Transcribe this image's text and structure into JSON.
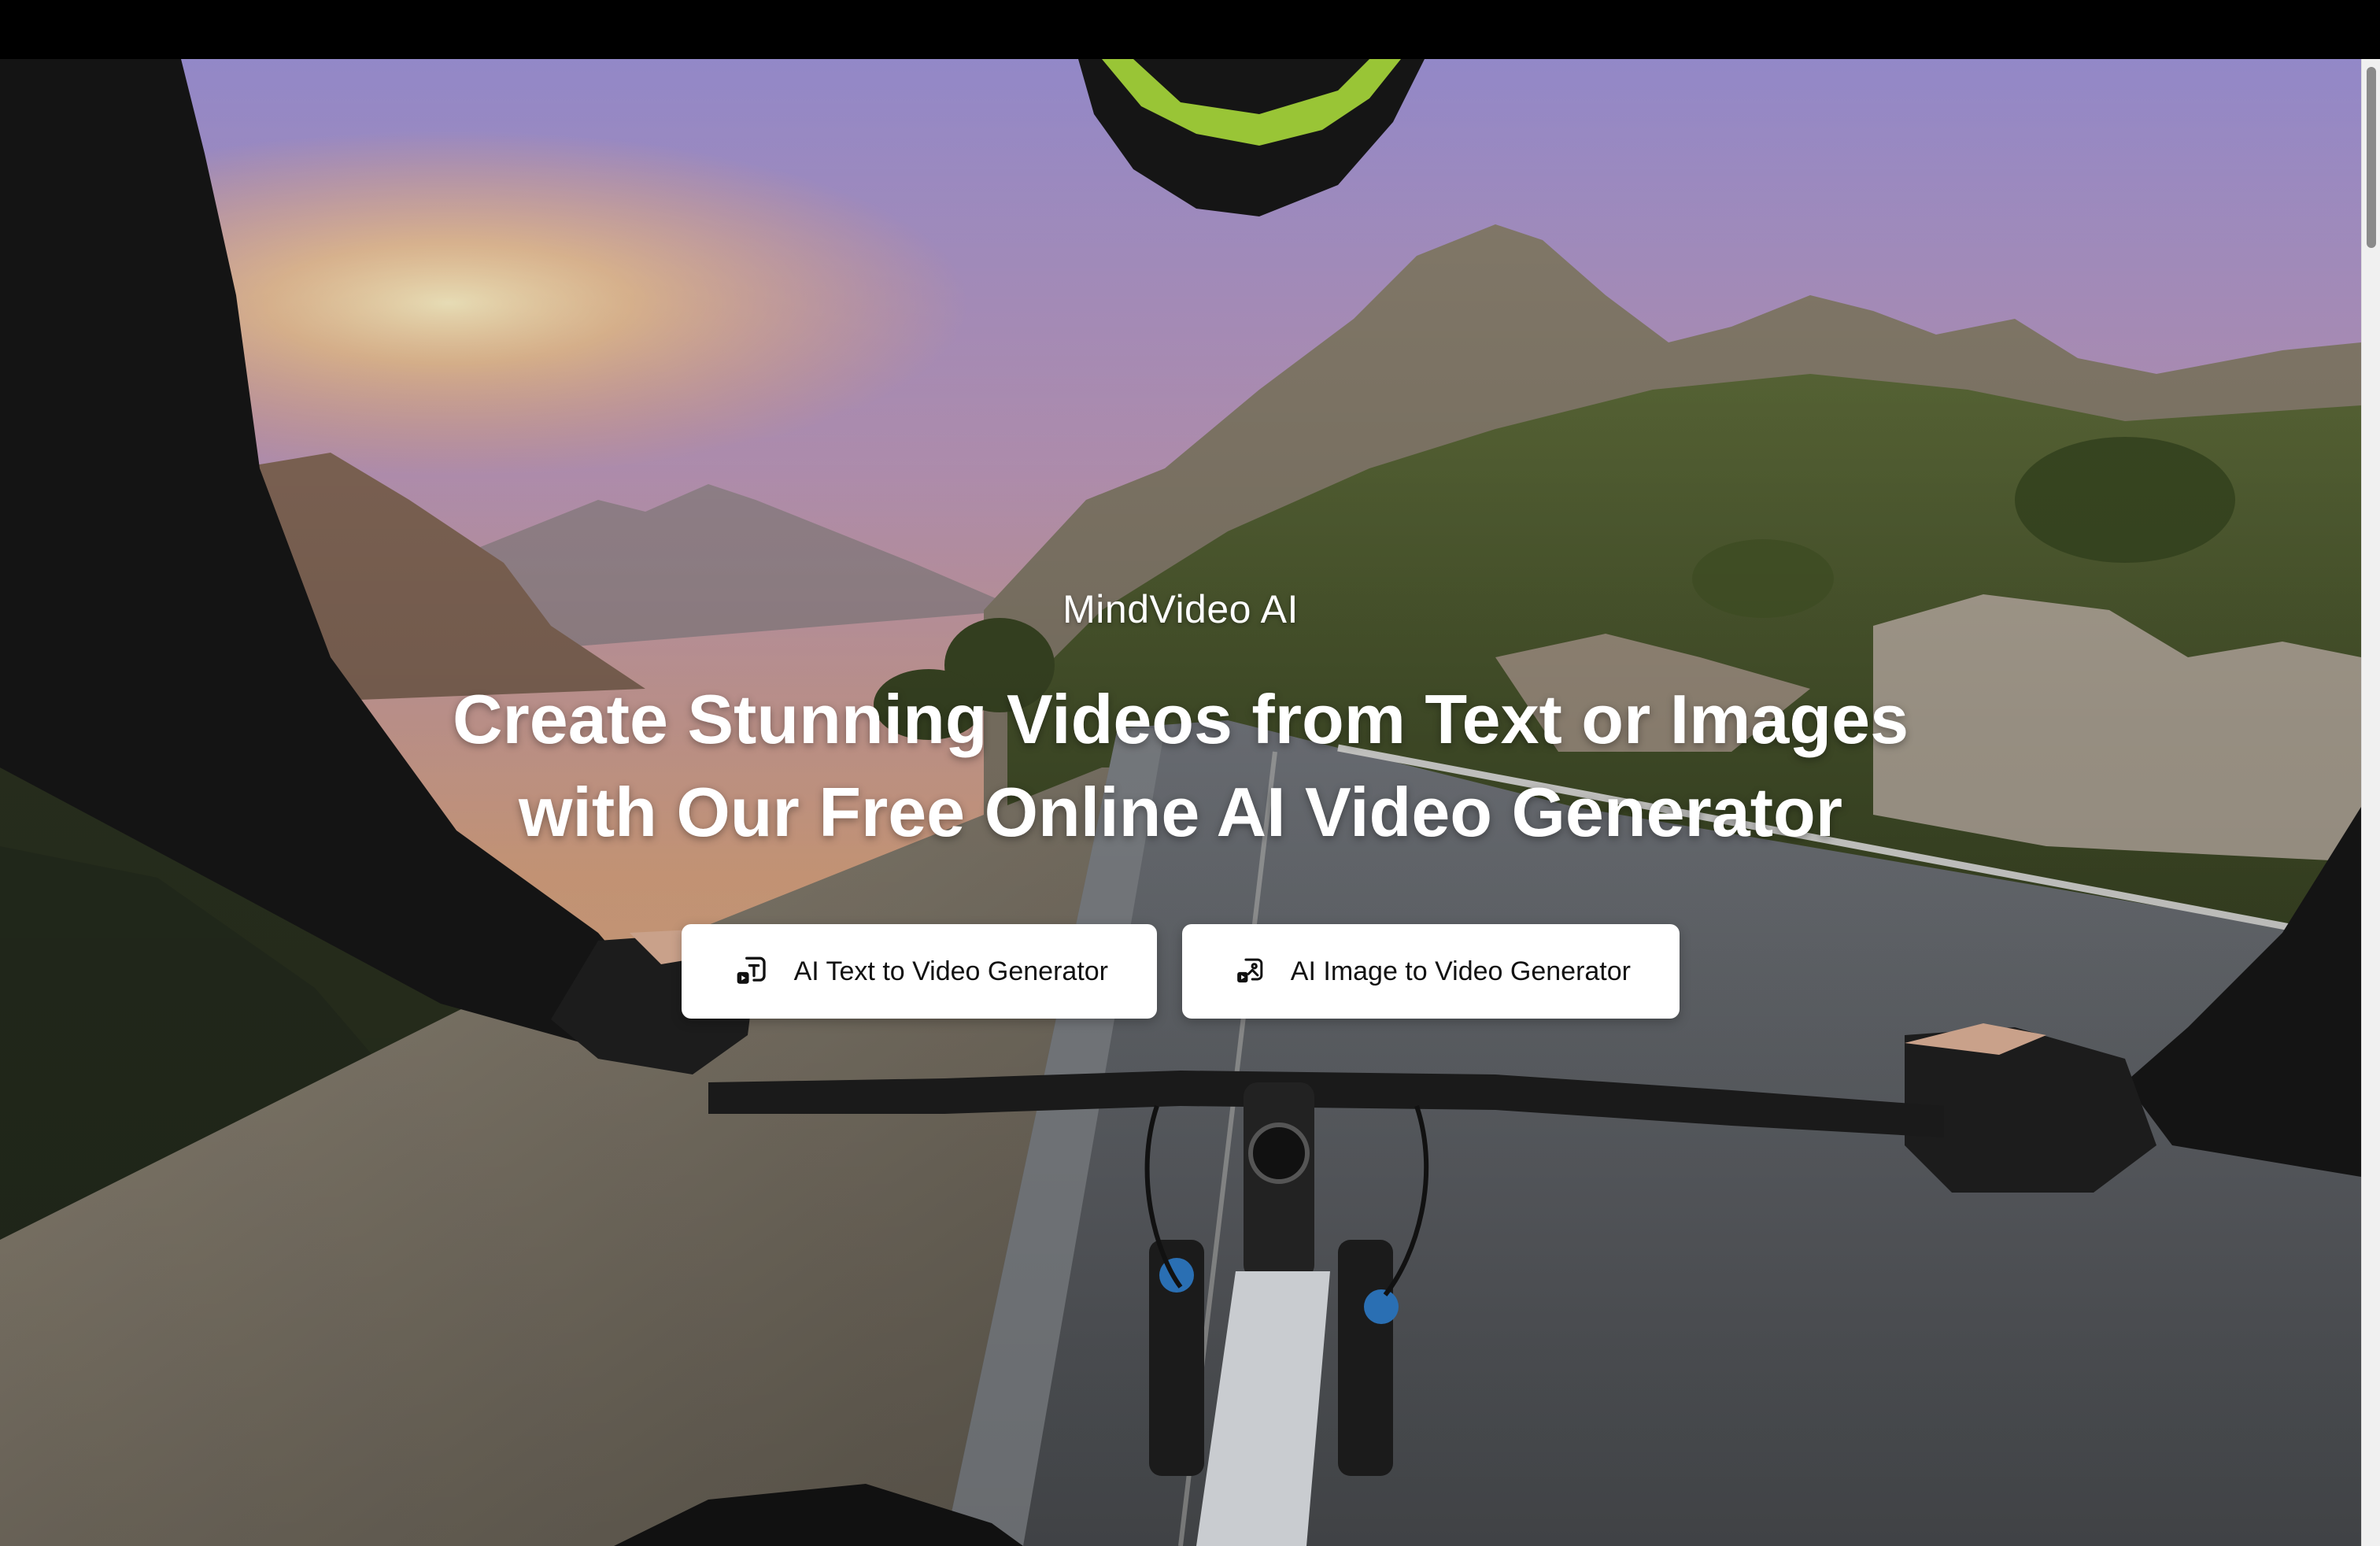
{
  "brand": "MindVideo AI",
  "headline": {
    "line1": "Create Stunning Videos from Text or Images",
    "line2": "with Our Free Online AI Video Generator"
  },
  "buttons": [
    {
      "label": "AI Text to Video Generator",
      "icon": "text-to-video-icon"
    },
    {
      "label": "AI Image to Video Generator",
      "icon": "image-to-video-icon"
    }
  ],
  "colors": {
    "button_bg": "#ffffff",
    "button_text": "#111111",
    "headline": "#ffffff"
  }
}
